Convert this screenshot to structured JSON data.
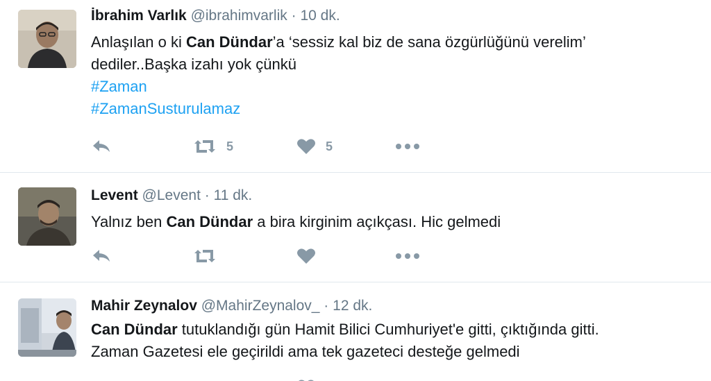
{
  "tweets": [
    {
      "fullname": "İbrahim Varlık",
      "username": "@ibrahimvarlik",
      "time": "10 dk.",
      "line1_pre": "Anlaşılan o ki ",
      "line1_bold": "Can Dündar",
      "line1_post": "’a ‘sessiz kal biz de sana özgürlüğünü verelim’",
      "line2": "dediler..Başka izahı yok çünkü",
      "hashtags": [
        "#Zaman",
        "#ZamanSusturulamaz"
      ],
      "retweet_count": "5",
      "like_count": "5"
    },
    {
      "fullname": "Levent",
      "username": "@Levent",
      "time": "11 dk.",
      "line1_pre": "Yalnız ben ",
      "line1_bold": "Can Dündar",
      "line1_post": " a bira kirginim açıkçası. Hic gelmedi",
      "retweet_count": "",
      "like_count": ""
    },
    {
      "fullname": "Mahir Zeynalov",
      "username": "@MahirZeynalov_",
      "time": "12 dk.",
      "line1_bold": "Can Dündar",
      "line1_post": " tutuklandığı gün Hamit Bilici Cumhuriyet'e gitti, çıktığında gitti.",
      "line2": "Zaman Gazetesi ele geçirildi ama tek gazeteci desteğe gelmedi"
    }
  ],
  "separator": "·",
  "icons": {
    "reply": "reply-icon",
    "retweet": "retweet-icon",
    "like": "heart-icon",
    "more": "more-icon"
  },
  "colors": {
    "hashtag": "#1da1f2",
    "secondary_text": "#657786",
    "action_icon": "#8899a6",
    "divider": "#e1e8ed"
  }
}
